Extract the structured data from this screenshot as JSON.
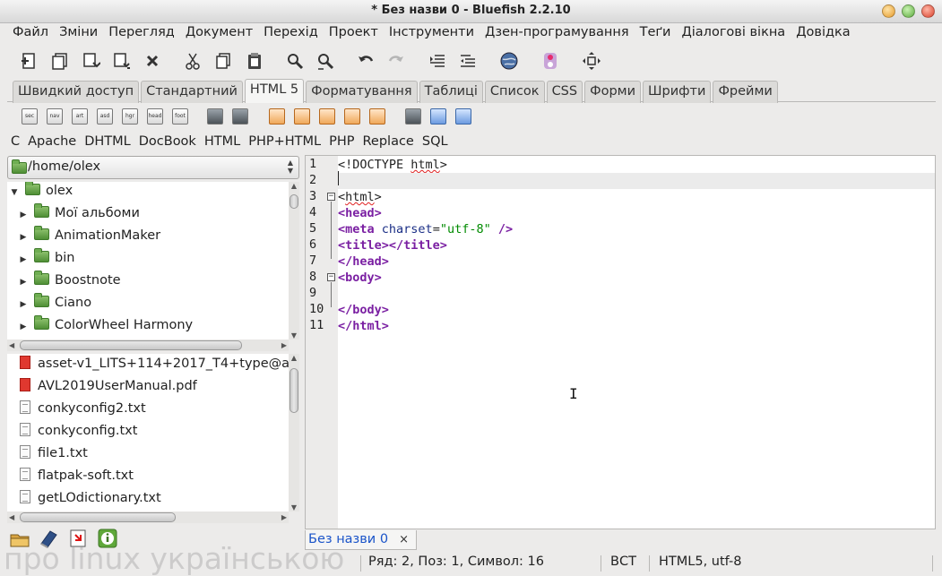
{
  "window": {
    "title": "* Без назви 0 - Bluefish 2.2.10"
  },
  "menu": [
    "Файл",
    "Зміни",
    "Перегляд",
    "Документ",
    "Перехід",
    "Проект",
    "Інструменти",
    "Дзен-програмування",
    "Теґи",
    "Діалогові вікна",
    "Довідка"
  ],
  "toolbar_icons": [
    "new-file-icon",
    "new-window-icon",
    "save-icon",
    "save-as-icon",
    "close-icon",
    "cut-icon",
    "copy-icon",
    "paste-icon",
    "search-icon",
    "search-replace-icon",
    "undo-icon",
    "redo-icon",
    "unindent-icon",
    "indent-icon",
    "preview-browser-icon",
    "toggle-icon",
    "fullscreen-icon"
  ],
  "tabs": [
    "Швидкий доступ",
    "Стандартний",
    "HTML 5",
    "Форматування",
    "Таблиці",
    "Список",
    "CSS",
    "Форми",
    "Шрифти",
    "Фрейми"
  ],
  "active_tab": "HTML 5",
  "html5_icons": [
    "sec",
    "nav",
    "art",
    "asd",
    "hgr",
    "head",
    "foot",
    "",
    "",
    "",
    "",
    "",
    "",
    "",
    "",
    "",
    ""
  ],
  "snippets": [
    "C",
    "Apache",
    "DHTML",
    "DocBook",
    "HTML",
    "PHP+HTML",
    "PHP",
    "Replace",
    "SQL"
  ],
  "sidebar": {
    "path": "/home/olex",
    "tree": [
      {
        "label": "olex",
        "expanded": true,
        "level": 0
      },
      {
        "label": "Мої альбоми",
        "level": 1
      },
      {
        "label": "AnimationMaker",
        "level": 1
      },
      {
        "label": "bin",
        "level": 1
      },
      {
        "label": "Boostnote",
        "level": 1
      },
      {
        "label": "Ciano",
        "level": 1
      },
      {
        "label": "ColorWheel Harmony",
        "level": 1
      }
    ],
    "files": [
      {
        "name": "asset-v1_LITS+114+2017_T4+type@a",
        "kind": "html"
      },
      {
        "name": "AVL2019UserManual.pdf",
        "kind": "pdf"
      },
      {
        "name": "conkyconfig2.txt",
        "kind": "txt"
      },
      {
        "name": "conkyconfig.txt",
        "kind": "txt"
      },
      {
        "name": "file1.txt",
        "kind": "txt"
      },
      {
        "name": "flatpak-soft.txt",
        "kind": "txt"
      },
      {
        "name": "getLOdictionary.txt",
        "kind": "txt"
      }
    ]
  },
  "editor": {
    "line_numbers": [
      "1",
      "2",
      "3",
      "4",
      "5",
      "6",
      "7",
      "8",
      "9",
      "10",
      "11"
    ],
    "lines": [
      [
        {
          "t": "<!DOCTYPE ",
          "c": "plain"
        },
        {
          "t": "html",
          "c": "plain squig"
        },
        {
          "t": ">",
          "c": "plain"
        }
      ],
      [],
      [
        {
          "t": "<",
          "c": "plain"
        },
        {
          "t": "html",
          "c": "plain squig"
        },
        {
          "t": ">",
          "c": "plain"
        }
      ],
      [
        {
          "t": "<head>",
          "c": "tag"
        }
      ],
      [
        {
          "t": "<meta ",
          "c": "tag"
        },
        {
          "t": "charset",
          "c": "attr"
        },
        {
          "t": "=",
          "c": "plain"
        },
        {
          "t": "\"utf-8\"",
          "c": "str"
        },
        {
          "t": " />",
          "c": "tag"
        }
      ],
      [
        {
          "t": "<title></title>",
          "c": "tag"
        }
      ],
      [
        {
          "t": "</head>",
          "c": "tag"
        }
      ],
      [
        {
          "t": "<body>",
          "c": "tag"
        }
      ],
      [],
      [
        {
          "t": "</body>",
          "c": "tag"
        }
      ],
      [
        {
          "t": "</html>",
          "c": "tag"
        }
      ]
    ]
  },
  "document_tab": {
    "label": "Без назви 0",
    "close": "×"
  },
  "status": {
    "position": "Ряд: 2, Поз: 1, Символ: 16",
    "mode": "ВСТ",
    "encoding": "HTML5, utf-8"
  },
  "watermark": "про linux українською"
}
